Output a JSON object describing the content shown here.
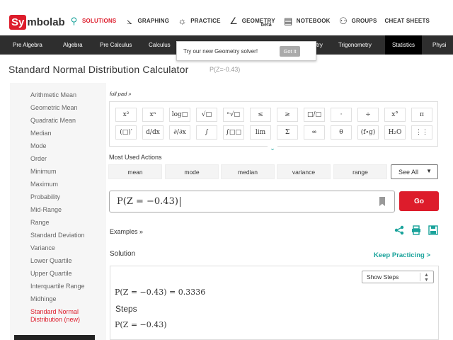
{
  "logo": {
    "sy": "Sy",
    "rest": "mbolab"
  },
  "topnav": [
    {
      "label": "SOLUTIONS",
      "icon": "search-icon",
      "glyph": "⚲",
      "active": true
    },
    {
      "label": "GRAPHING",
      "icon": "graph-icon",
      "glyph": "⦣",
      "active": false
    },
    {
      "label": "PRACTICE",
      "icon": "bulb-icon",
      "glyph": "☼",
      "active": false
    },
    {
      "label": "GEOMETRY",
      "icon": "angle-icon",
      "glyph": "∠",
      "active": false
    },
    {
      "label": "NOTEBOOK",
      "icon": "notebook-icon",
      "glyph": "▤",
      "active": false
    },
    {
      "label": "GROUPS",
      "icon": "groups-icon",
      "glyph": "⚇",
      "active": false
    },
    {
      "label": "CHEAT SHEETS",
      "icon": "",
      "glyph": "",
      "active": false
    }
  ],
  "geometry_badge": "beta",
  "categories": [
    {
      "label": "Pre Algebra",
      "active": false
    },
    {
      "label": "Algebra",
      "active": false
    },
    {
      "label": "Pre Calculus",
      "active": false
    },
    {
      "label": "Calculus",
      "active": false
    },
    {
      "label": "try",
      "active": false
    },
    {
      "label": "Trigonometry",
      "active": false
    },
    {
      "label": "Statistics",
      "active": true
    },
    {
      "label": "Physi",
      "active": false
    }
  ],
  "popup": {
    "text": "Try our new Geometry solver!",
    "button": "Got it"
  },
  "page": {
    "title": "Standard Normal Distribution Calculator",
    "subtitle": "P(Z=-0.43)"
  },
  "sidebar": [
    {
      "label": "Arithmetic Mean",
      "active": false
    },
    {
      "label": "Geometric Mean",
      "active": false
    },
    {
      "label": "Quadratic Mean",
      "active": false
    },
    {
      "label": "Median",
      "active": false
    },
    {
      "label": "Mode",
      "active": false
    },
    {
      "label": "Order",
      "active": false
    },
    {
      "label": "Minimum",
      "active": false
    },
    {
      "label": "Maximum",
      "active": false
    },
    {
      "label": "Probability",
      "active": false
    },
    {
      "label": "Mid-Range",
      "active": false
    },
    {
      "label": "Range",
      "active": false
    },
    {
      "label": "Standard Deviation",
      "active": false
    },
    {
      "label": "Variance",
      "active": false
    },
    {
      "label": "Lower Quartile",
      "active": false
    },
    {
      "label": "Upper Quartile",
      "active": false
    },
    {
      "label": "Interquartile Range",
      "active": false
    },
    {
      "label": "Midhinge",
      "active": false
    },
    {
      "label": "Standard Normal\nDistribution (new)",
      "active": true
    }
  ],
  "fullpad": "full pad »",
  "keypad": {
    "row1": [
      "x²",
      "xⁿ",
      "log□",
      "√□",
      "ⁿ√□",
      "≤",
      "≥",
      "□/□",
      "·",
      "÷",
      "x°",
      "π"
    ],
    "row2": [
      "(□)′",
      "d/dx",
      "∂/∂x",
      "∫",
      "∫□□",
      "lim",
      "Σ",
      "∞",
      "θ",
      "(f∘g)",
      "H₂O",
      "⋮⋮"
    ]
  },
  "most_used": {
    "label": "Most Used Actions",
    "actions": [
      "mean",
      "mode",
      "median",
      "variance",
      "range"
    ],
    "see_all": "See All"
  },
  "input": {
    "value": "P(Z = −0.43)"
  },
  "go_label": "Go",
  "examples_label": "Examples »",
  "share_icons": [
    "share-icon",
    "print-icon",
    "save-icon"
  ],
  "solution_label": "Solution",
  "keep_practicing": "Keep Practicing >",
  "show_steps": "Show Steps",
  "result": "P(Z = −0.43) = 0.3336",
  "steps_label": "Steps",
  "step_expr": "P(Z = −0.43)",
  "colors": {
    "brand_red": "#dd1c2b",
    "accent_teal": "#1aa39b",
    "nav_dark": "#2e2e2e"
  }
}
